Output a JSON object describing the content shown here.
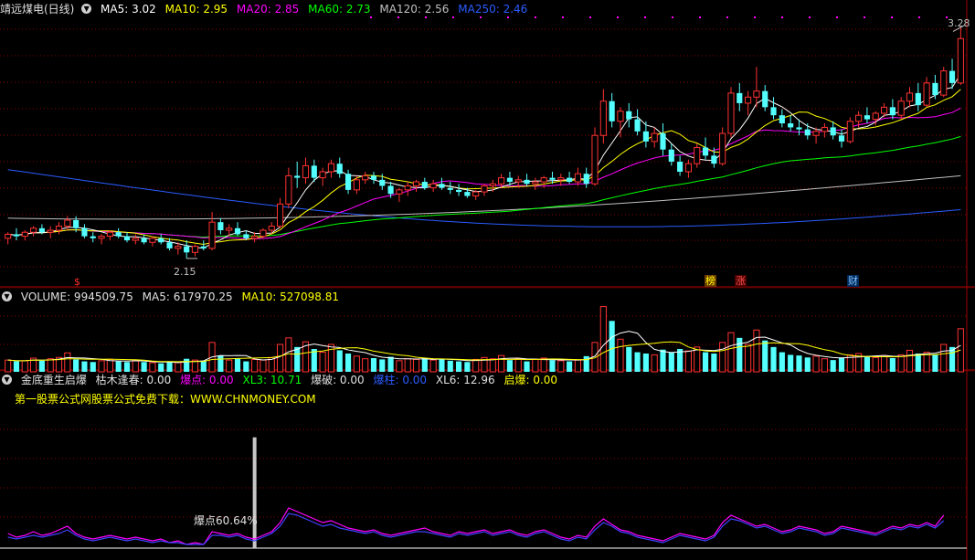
{
  "price_header": {
    "title": "靖远煤电(日线)",
    "ma5": "MA5: 3.02",
    "ma10": "MA10: 2.95",
    "ma20": "MA20: 2.85",
    "ma60": "MA60: 2.73",
    "ma120": "MA120: 2.56",
    "ma250": "MA250: 2.46"
  },
  "volume_header": {
    "label": "VOLUME: 994509.75",
    "ma5": "MA5: 617970.25",
    "ma10": "MA10: 527098.81"
  },
  "indicator_header": {
    "name": "金底重生启爆",
    "kumu": "枯木逢春: 0.00",
    "baodian": "爆点: 0.00",
    "xl3": "XL3: 10.71",
    "baopo": "爆破: 0.00",
    "baozhu": "爆柱: 0.00",
    "xl6": "XL6: 12.96",
    "qibao": "启爆: 0.00"
  },
  "url_text": "第一股票公式网股票公式免费下载：WWW.CHNMONEY.COM",
  "price_labels": {
    "high": "3.28",
    "low": "2.15",
    "indicator_peak": "爆点60.64%"
  },
  "marks": [
    {
      "text": "$",
      "color": "#ff3030"
    },
    {
      "text": "榜",
      "color": "#ffff00"
    },
    {
      "text": "涨",
      "color": "#ff5050"
    },
    {
      "text": "财",
      "color": "#80c0ff"
    }
  ],
  "colors": {
    "up": "#ff3232",
    "down": "#54ffff",
    "ma5": "#ffffff",
    "ma10": "#ffff00",
    "ma20": "#ff00ff",
    "ma60": "#00ff00",
    "ma120": "#c0c0c0",
    "ma250": "#2a5cff",
    "grid": "#8a0000",
    "label": "#c8c8c8"
  },
  "chart_data": [
    {
      "type": "candlestick",
      "title": "靖远煤电(日线)",
      "ylim": [
        2.05,
        3.35
      ],
      "high_marker": 3.28,
      "low_marker": 2.15,
      "ohlc": [
        [
          2.25,
          2.28,
          2.22,
          2.27
        ],
        [
          2.27,
          2.3,
          2.24,
          2.26
        ],
        [
          2.26,
          2.29,
          2.24,
          2.28
        ],
        [
          2.28,
          2.31,
          2.26,
          2.3
        ],
        [
          2.3,
          2.32,
          2.27,
          2.28
        ],
        [
          2.28,
          2.31,
          2.25,
          2.29
        ],
        [
          2.29,
          2.33,
          2.27,
          2.31
        ],
        [
          2.31,
          2.36,
          2.29,
          2.34
        ],
        [
          2.34,
          2.36,
          2.28,
          2.3
        ],
        [
          2.3,
          2.32,
          2.25,
          2.26
        ],
        [
          2.26,
          2.28,
          2.23,
          2.25
        ],
        [
          2.25,
          2.27,
          2.22,
          2.26
        ],
        [
          2.26,
          2.29,
          2.24,
          2.28
        ],
        [
          2.28,
          2.3,
          2.25,
          2.26
        ],
        [
          2.26,
          2.28,
          2.23,
          2.24
        ],
        [
          2.24,
          2.27,
          2.22,
          2.25
        ],
        [
          2.25,
          2.27,
          2.22,
          2.23
        ],
        [
          2.23,
          2.26,
          2.21,
          2.25
        ],
        [
          2.25,
          2.27,
          2.22,
          2.23
        ],
        [
          2.23,
          2.25,
          2.19,
          2.2
        ],
        [
          2.2,
          2.23,
          2.17,
          2.21
        ],
        [
          2.21,
          2.24,
          2.15,
          2.18
        ],
        [
          2.18,
          2.22,
          2.16,
          2.21
        ],
        [
          2.21,
          2.24,
          2.19,
          2.2
        ],
        [
          2.2,
          2.38,
          2.19,
          2.33
        ],
        [
          2.33,
          2.35,
          2.27,
          2.29
        ],
        [
          2.29,
          2.32,
          2.26,
          2.3
        ],
        [
          2.3,
          2.33,
          2.26,
          2.27
        ],
        [
          2.27,
          2.29,
          2.24,
          2.25
        ],
        [
          2.25,
          2.28,
          2.23,
          2.26
        ],
        [
          2.26,
          2.3,
          2.25,
          2.29
        ],
        [
          2.29,
          2.33,
          2.27,
          2.31
        ],
        [
          2.31,
          2.45,
          2.3,
          2.42
        ],
        [
          2.42,
          2.6,
          2.4,
          2.56
        ],
        [
          2.56,
          2.63,
          2.5,
          2.55
        ],
        [
          2.55,
          2.65,
          2.52,
          2.61
        ],
        [
          2.61,
          2.64,
          2.53,
          2.55
        ],
        [
          2.55,
          2.6,
          2.51,
          2.58
        ],
        [
          2.58,
          2.64,
          2.55,
          2.62
        ],
        [
          2.62,
          2.65,
          2.55,
          2.57
        ],
        [
          2.57,
          2.59,
          2.47,
          2.49
        ],
        [
          2.49,
          2.56,
          2.47,
          2.54
        ],
        [
          2.54,
          2.58,
          2.52,
          2.56
        ],
        [
          2.56,
          2.58,
          2.52,
          2.54
        ],
        [
          2.54,
          2.57,
          2.49,
          2.51
        ],
        [
          2.51,
          2.53,
          2.45,
          2.47
        ],
        [
          2.47,
          2.5,
          2.43,
          2.49
        ],
        [
          2.49,
          2.53,
          2.46,
          2.51
        ],
        [
          2.51,
          2.54,
          2.48,
          2.53
        ],
        [
          2.53,
          2.55,
          2.49,
          2.5
        ],
        [
          2.5,
          2.54,
          2.48,
          2.52
        ],
        [
          2.52,
          2.55,
          2.49,
          2.5
        ],
        [
          2.5,
          2.53,
          2.47,
          2.49
        ],
        [
          2.49,
          2.52,
          2.46,
          2.48
        ],
        [
          2.48,
          2.5,
          2.45,
          2.46
        ],
        [
          2.46,
          2.49,
          2.44,
          2.48
        ],
        [
          2.48,
          2.52,
          2.46,
          2.51
        ],
        [
          2.51,
          2.54,
          2.48,
          2.52
        ],
        [
          2.52,
          2.57,
          2.5,
          2.55
        ],
        [
          2.55,
          2.58,
          2.51,
          2.53
        ],
        [
          2.53,
          2.56,
          2.5,
          2.54
        ],
        [
          2.54,
          2.57,
          2.51,
          2.52
        ],
        [
          2.52,
          2.55,
          2.49,
          2.53
        ],
        [
          2.53,
          2.56,
          2.5,
          2.55
        ],
        [
          2.55,
          2.58,
          2.52,
          2.54
        ],
        [
          2.54,
          2.57,
          2.51,
          2.55
        ],
        [
          2.55,
          2.58,
          2.52,
          2.53
        ],
        [
          2.53,
          2.6,
          2.51,
          2.57
        ],
        [
          2.57,
          2.6,
          2.5,
          2.52
        ],
        [
          2.52,
          2.8,
          2.51,
          2.76
        ],
        [
          2.76,
          2.99,
          2.72,
          2.93
        ],
        [
          2.93,
          2.97,
          2.8,
          2.83
        ],
        [
          2.83,
          2.9,
          2.75,
          2.88
        ],
        [
          2.88,
          2.92,
          2.8,
          2.84
        ],
        [
          2.84,
          2.89,
          2.76,
          2.78
        ],
        [
          2.78,
          2.83,
          2.7,
          2.73
        ],
        [
          2.73,
          2.8,
          2.7,
          2.77
        ],
        [
          2.77,
          2.82,
          2.66,
          2.69
        ],
        [
          2.69,
          2.72,
          2.61,
          2.63
        ],
        [
          2.63,
          2.66,
          2.56,
          2.58
        ],
        [
          2.58,
          2.64,
          2.55,
          2.62
        ],
        [
          2.62,
          2.72,
          2.6,
          2.7
        ],
        [
          2.7,
          2.75,
          2.64,
          2.66
        ],
        [
          2.66,
          2.7,
          2.6,
          2.62
        ],
        [
          2.62,
          2.8,
          2.61,
          2.77
        ],
        [
          2.77,
          3.0,
          2.75,
          2.97
        ],
        [
          2.97,
          3.02,
          2.88,
          2.92
        ],
        [
          2.92,
          2.98,
          2.86,
          2.95
        ],
        [
          2.95,
          3.1,
          2.9,
          2.98
        ],
        [
          2.98,
          3.01,
          2.88,
          2.9
        ],
        [
          2.9,
          2.95,
          2.84,
          2.86
        ],
        [
          2.86,
          2.89,
          2.8,
          2.82
        ],
        [
          2.82,
          2.86,
          2.78,
          2.8
        ],
        [
          2.8,
          2.84,
          2.76,
          2.79
        ],
        [
          2.79,
          2.82,
          2.74,
          2.76
        ],
        [
          2.76,
          2.8,
          2.72,
          2.78
        ],
        [
          2.78,
          2.82,
          2.75,
          2.8
        ],
        [
          2.8,
          2.83,
          2.74,
          2.76
        ],
        [
          2.76,
          2.79,
          2.7,
          2.73
        ],
        [
          2.73,
          2.85,
          2.72,
          2.83
        ],
        [
          2.83,
          2.88,
          2.8,
          2.86
        ],
        [
          2.86,
          2.9,
          2.82,
          2.84
        ],
        [
          2.84,
          2.88,
          2.81,
          2.87
        ],
        [
          2.87,
          2.92,
          2.85,
          2.9
        ],
        [
          2.9,
          2.94,
          2.84,
          2.86
        ],
        [
          2.86,
          2.95,
          2.84,
          2.93
        ],
        [
          2.93,
          3.0,
          2.9,
          2.97
        ],
        [
          2.97,
          3.02,
          2.88,
          2.91
        ],
        [
          2.91,
          3.05,
          2.9,
          3.02
        ],
        [
          3.02,
          3.06,
          2.94,
          2.96
        ],
        [
          2.96,
          3.1,
          2.95,
          3.08
        ],
        [
          3.08,
          3.14,
          2.99,
          3.02
        ],
        [
          3.02,
          3.3,
          3.01,
          3.24
        ]
      ],
      "ma_last": {
        "MA5": 3.02,
        "MA10": 2.95,
        "MA20": 2.85,
        "MA60": 2.73,
        "MA120": 2.56,
        "MA250": 2.46
      },
      "ma250_endpoints": [
        2.59,
        2.46
      ],
      "ma120_endpoints": [
        2.35,
        2.56
      ]
    },
    {
      "type": "bar",
      "title": "VOLUME",
      "ylim": [
        0,
        1050000
      ],
      "last_volume": 994509.75,
      "last_ma5": 617970.25,
      "last_ma10": 527098.81,
      "values": [
        180000,
        160000,
        170000,
        210000,
        170000,
        200000,
        220000,
        290000,
        190000,
        160000,
        150000,
        170000,
        190000,
        160000,
        150000,
        180000,
        150000,
        140000,
        130000,
        150000,
        140000,
        200000,
        180000,
        170000,
        450000,
        250000,
        180000,
        200000,
        160000,
        190000,
        180000,
        220000,
        420000,
        520000,
        380000,
        460000,
        350000,
        300000,
        420000,
        330000,
        280000,
        240000,
        200000,
        210000,
        190000,
        230000,
        170000,
        200000,
        190000,
        210000,
        180000,
        200000,
        170000,
        160000,
        150000,
        190000,
        220000,
        200000,
        250000,
        180000,
        200000,
        160000,
        190000,
        210000,
        180000,
        170000,
        160000,
        180000,
        240000,
        450000,
        1000000,
        780000,
        500000,
        380000,
        300000,
        280000,
        260000,
        340000,
        300000,
        350000,
        320000,
        380000,
        300000,
        280000,
        450000,
        600000,
        520000,
        420000,
        640000,
        480000,
        380000,
        300000,
        260000,
        250000,
        220000,
        240000,
        200000,
        180000,
        220000,
        260000,
        280000,
        240000,
        220000,
        250000,
        210000,
        260000,
        330000,
        280000,
        300000,
        260000,
        420000,
        380000,
        660000
      ]
    },
    {
      "type": "line",
      "title": "金底重生启爆",
      "ylim": [
        0,
        65
      ],
      "spike": {
        "index": 29,
        "value": 60.64
      },
      "series": [
        {
          "name": "XL3",
          "values": [
            8,
            6,
            7,
            9,
            7,
            8,
            10,
            12,
            8,
            6,
            5,
            6,
            7,
            6,
            5,
            6,
            5,
            4,
            5,
            3,
            4,
            2,
            3,
            2,
            9,
            8,
            7,
            8,
            6,
            5,
            7,
            9,
            14,
            22,
            20,
            18,
            16,
            14,
            15,
            13,
            11,
            10,
            9,
            10,
            8,
            7,
            8,
            9,
            10,
            11,
            9,
            8,
            7,
            9,
            8,
            9,
            10,
            8,
            9,
            10,
            8,
            7,
            9,
            10,
            8,
            6,
            5,
            7,
            6,
            12,
            16,
            13,
            10,
            9,
            7,
            6,
            5,
            4,
            6,
            8,
            7,
            6,
            5,
            7,
            14,
            18,
            16,
            14,
            12,
            13,
            11,
            9,
            10,
            12,
            11,
            10,
            8,
            9,
            12,
            11,
            10,
            9,
            8,
            10,
            12,
            11,
            13,
            12,
            14,
            12,
            18
          ]
        },
        {
          "name": "XL6",
          "values": [
            6,
            5,
            6,
            7,
            6,
            7,
            8,
            10,
            7,
            5,
            4,
            5,
            6,
            5,
            4,
            5,
            4,
            3,
            4,
            3,
            3,
            2,
            2,
            2,
            7,
            7,
            6,
            7,
            5,
            4,
            6,
            8,
            12,
            19,
            18,
            16,
            14,
            12,
            13,
            11,
            10,
            9,
            8,
            9,
            7,
            6,
            7,
            8,
            9,
            9,
            8,
            7,
            6,
            8,
            7,
            8,
            9,
            7,
            8,
            9,
            7,
            6,
            8,
            9,
            7,
            5,
            4,
            6,
            5,
            10,
            14,
            12,
            9,
            8,
            6,
            5,
            4,
            3,
            5,
            7,
            6,
            5,
            4,
            6,
            12,
            16,
            15,
            13,
            11,
            12,
            10,
            8,
            9,
            11,
            10,
            9,
            7,
            8,
            11,
            10,
            9,
            8,
            7,
            9,
            11,
            10,
            12,
            11,
            13,
            11,
            15
          ]
        }
      ]
    }
  ]
}
